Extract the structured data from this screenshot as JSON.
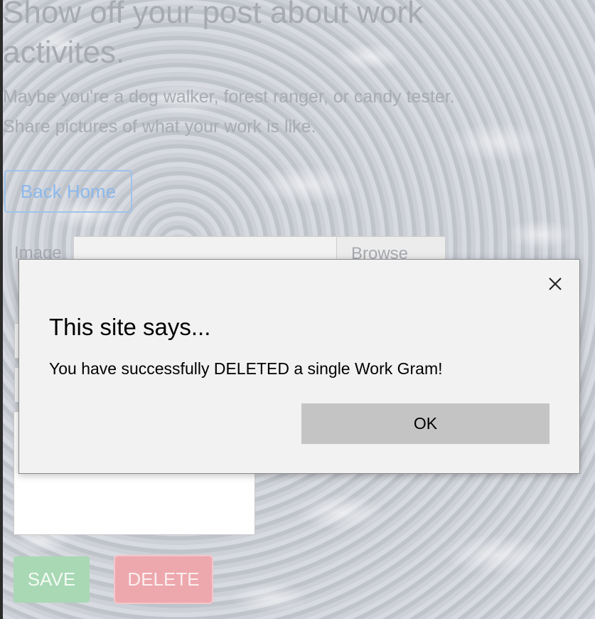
{
  "page": {
    "heading": "Show off your post about work activites.",
    "subtext_line1": "Maybe you're a dog walker, forest ranger, or candy tester.",
    "subtext_line2": "Share pictures of what your work is like.",
    "back_button": "Back Home",
    "image_label": "Image",
    "browse_button": "Browse",
    "field_placeholder_1": "",
    "field_placeholder_2": "",
    "save_button": "SAVE",
    "delete_button": "DELETE"
  },
  "dialog": {
    "title": "This site says...",
    "message": "You have successfully DELETED a single Work Gram!",
    "ok_button": "OK",
    "close_icon": "close-icon"
  },
  "colors": {
    "save": "#a8d8b4",
    "delete": "#eda8ae",
    "back_border": "#9fc3ec",
    "dialog_bg": "#f2f2f2",
    "ok_bg": "#c4c4c4"
  }
}
